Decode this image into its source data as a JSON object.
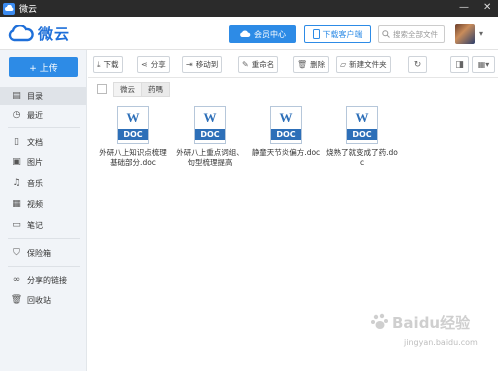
{
  "window": {
    "title": "微云",
    "minimize_glyph": "—",
    "close_glyph": "✕"
  },
  "header": {
    "brand": "微云",
    "vip_label": "会员中心",
    "client_label": "下载客户端",
    "search_placeholder": "搜索全部文件"
  },
  "sidebar": {
    "upload_label": "+ 上传",
    "items": [
      {
        "label": "目录",
        "icon": "directory-icon"
      },
      {
        "label": "最近",
        "icon": "clock-icon"
      },
      {
        "label": "文档",
        "icon": "document-icon"
      },
      {
        "label": "图片",
        "icon": "image-icon"
      },
      {
        "label": "音乐",
        "icon": "music-icon"
      },
      {
        "label": "视频",
        "icon": "video-icon"
      },
      {
        "label": "笔记",
        "icon": "note-icon"
      },
      {
        "label": "保险箱",
        "icon": "shield-icon"
      },
      {
        "label": "分享的链接",
        "icon": "link-icon"
      },
      {
        "label": "回收站",
        "icon": "trash-icon"
      }
    ]
  },
  "toolbar": {
    "download": "下载",
    "share": "分享",
    "move": "移动到",
    "rename": "重命名",
    "delete": "删除",
    "new_folder": "新建文件夹"
  },
  "breadcrumb": [
    "微云",
    "药嗎"
  ],
  "files": [
    {
      "type_label": "DOC",
      "name": "外研八上知识点梳理基础部分.doc"
    },
    {
      "type_label": "DOC",
      "name": "外研八上重点词组、句型梳理提高"
    },
    {
      "type_label": "DOC",
      "name": "静童天节炎偏方.doc"
    },
    {
      "type_label": "DOC",
      "name": "烧熟了就变成了药.doc"
    }
  ],
  "watermark": {
    "line1": "Baidu经验",
    "line2": "jingyan.baidu.com"
  },
  "colors": {
    "accent": "#2d8be6",
    "titlebar": "#2b2b2b",
    "sidebar_bg": "#f1f4f8",
    "doc_blue": "#2d6fb8"
  }
}
